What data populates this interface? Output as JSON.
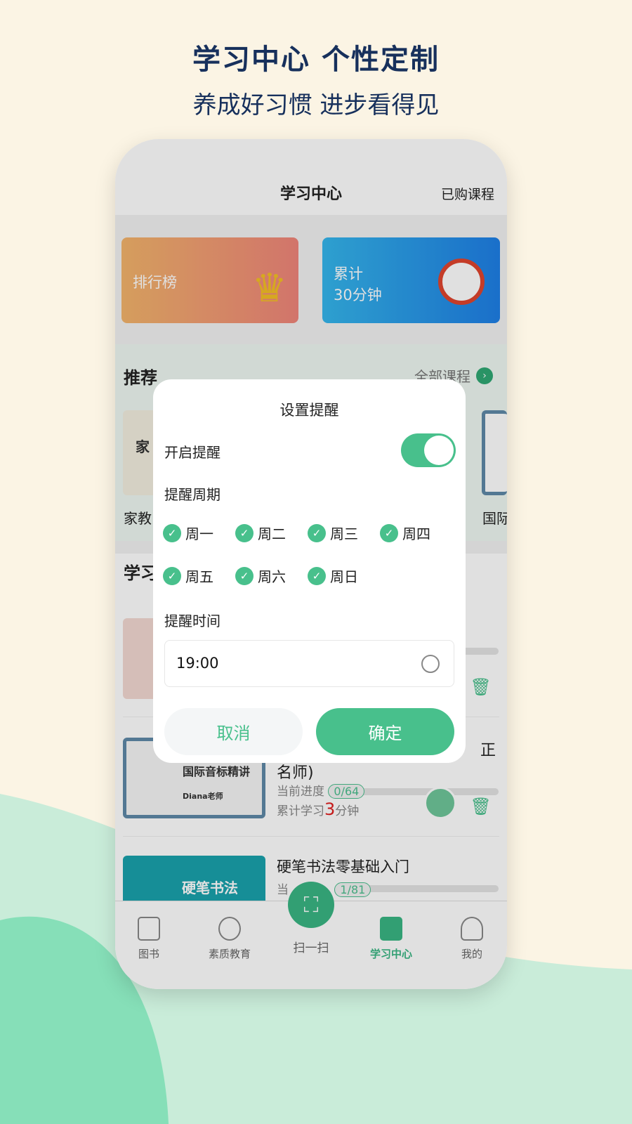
{
  "promo": {
    "headline": "学习中心  个性定制",
    "subline": "养成好习惯 进步看得见"
  },
  "header": {
    "title": "学习中心",
    "purchased": "已购课程"
  },
  "cards": {
    "ranking": "排行榜",
    "total_label": "累计",
    "total_value": "30分钟"
  },
  "recommend": {
    "title": "推荐",
    "more": "全部课程",
    "items": [
      {
        "label": "家教"
      },
      {
        "label": "国际"
      }
    ],
    "thumb_text": "家"
  },
  "study": {
    "title": "学习",
    "items": [
      {
        "title_tail": "名师)",
        "title_cut": "正",
        "progress_label": "当前进度",
        "progress": "0/64",
        "total_prefix": "累计学习",
        "minutes": "3",
        "total_suffix": "分钟",
        "thumb_text": "国际音标精讲",
        "teacher": "Diana老师"
      },
      {
        "title": "硬笔书法零基础入门",
        "progress_label": "当",
        "progress": "1/81",
        "thumb_text": "硬笔书法"
      }
    ]
  },
  "nav": {
    "items": [
      {
        "label": "图书"
      },
      {
        "label": "素质教育"
      },
      {
        "label": "扫一扫"
      },
      {
        "label": "学习中心",
        "active": true
      },
      {
        "label": "我的"
      }
    ]
  },
  "modal": {
    "title": "设置提醒",
    "enable_label": "开启提醒",
    "enabled": true,
    "period_label": "提醒周期",
    "days": [
      {
        "label": "周一",
        "checked": true
      },
      {
        "label": "周二",
        "checked": true
      },
      {
        "label": "周三",
        "checked": true
      },
      {
        "label": "周四",
        "checked": true
      },
      {
        "label": "周五",
        "checked": true
      },
      {
        "label": "周六",
        "checked": true
      },
      {
        "label": "周日",
        "checked": true
      }
    ],
    "time_label": "提醒时间",
    "time_value": "19:00",
    "cancel": "取消",
    "confirm": "确定"
  },
  "colors": {
    "accent": "#48c08c",
    "headline": "#17305c",
    "highlight": "#e02020"
  }
}
